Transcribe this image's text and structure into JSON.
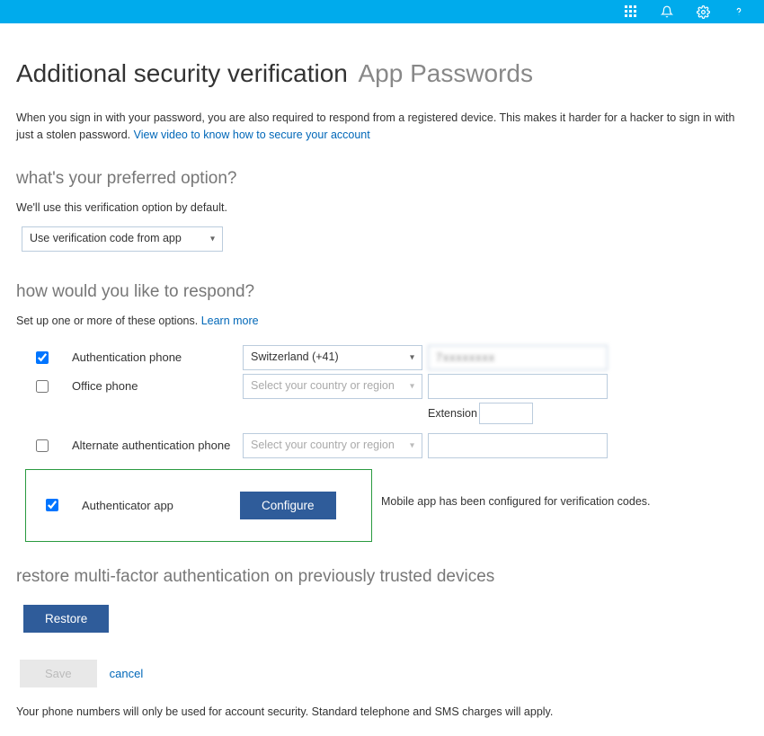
{
  "topbar": {
    "icons": [
      "apps-icon",
      "bell-icon",
      "gear-icon",
      "help-icon"
    ]
  },
  "title": {
    "main": "Additional security verification",
    "sub": "App Passwords"
  },
  "intro": {
    "text_before": "When you sign in with your password, you are also required to respond from a registered device. This makes it harder for a hacker to sign in with just a stolen password. ",
    "link": "View video to know how to secure your account"
  },
  "preferred": {
    "heading": "what's your preferred option?",
    "sub": "We'll use this verification option by default.",
    "selected": "Use verification code from app"
  },
  "respond": {
    "heading": "how would you like to respond?",
    "sub_before": "Set up one or more of these options. ",
    "learn_more": "Learn more",
    "options": [
      {
        "checked": true,
        "label": "Authentication phone",
        "country": "Switzerland (+41)",
        "country_disabled": false,
        "phone": "7xxxxxxxx"
      },
      {
        "checked": false,
        "label": "Office phone",
        "country": "Select your country or region",
        "country_disabled": true,
        "phone": ""
      },
      {
        "checked": false,
        "label": "Alternate authentication phone",
        "country": "Select your country or region",
        "country_disabled": true,
        "phone": ""
      }
    ],
    "extension_label": "Extension",
    "authenticator": {
      "checked": true,
      "label": "Authenticator app",
      "button": "Configure",
      "status": "Mobile app has been configured for verification codes."
    }
  },
  "restore": {
    "heading": "restore multi-factor authentication on previously trusted devices",
    "button": "Restore"
  },
  "footer": {
    "save": "Save",
    "cancel": "cancel",
    "note": "Your phone numbers will only be used for account security. Standard telephone and SMS charges will apply."
  }
}
